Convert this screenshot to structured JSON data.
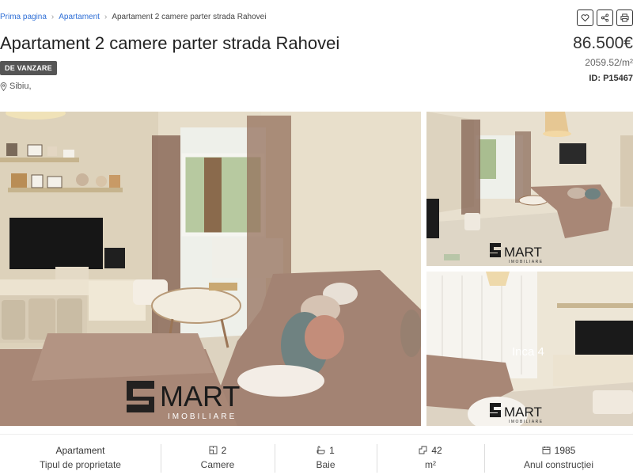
{
  "breadcrumb": {
    "home": "Prima pagina",
    "category": "Apartament",
    "current": "Apartament 2 camere parter strada Rahovei"
  },
  "listing": {
    "title": "Apartament 2 camere parter strada Rahovei",
    "status_badge": "DE VANZARE",
    "location": "Sibiu,",
    "price": "86.500€",
    "price_per_sqm": "2059.52/m²",
    "id_label": "ID: P15467"
  },
  "gallery": {
    "watermark_main": "MART",
    "watermark_sub": "IMOBILIARE",
    "more_label": "Inca 4"
  },
  "stats": [
    {
      "value": "Apartament",
      "label": "Tipul de proprietate",
      "icon": "none"
    },
    {
      "value": "2",
      "label": "Camere",
      "icon": "rooms-icon"
    },
    {
      "value": "1",
      "label": "Baie",
      "icon": "bath-icon"
    },
    {
      "value": "42",
      "label": "m²",
      "icon": "area-icon"
    },
    {
      "value": "1985",
      "label": "Anul construcției",
      "icon": "calendar-icon"
    }
  ],
  "icons": {
    "favorite": "heart-icon",
    "share": "share-icon",
    "print": "print-icon",
    "location": "map-pin-icon"
  },
  "colors": {
    "link": "#2f6fd6",
    "badge_bg": "#555555"
  }
}
